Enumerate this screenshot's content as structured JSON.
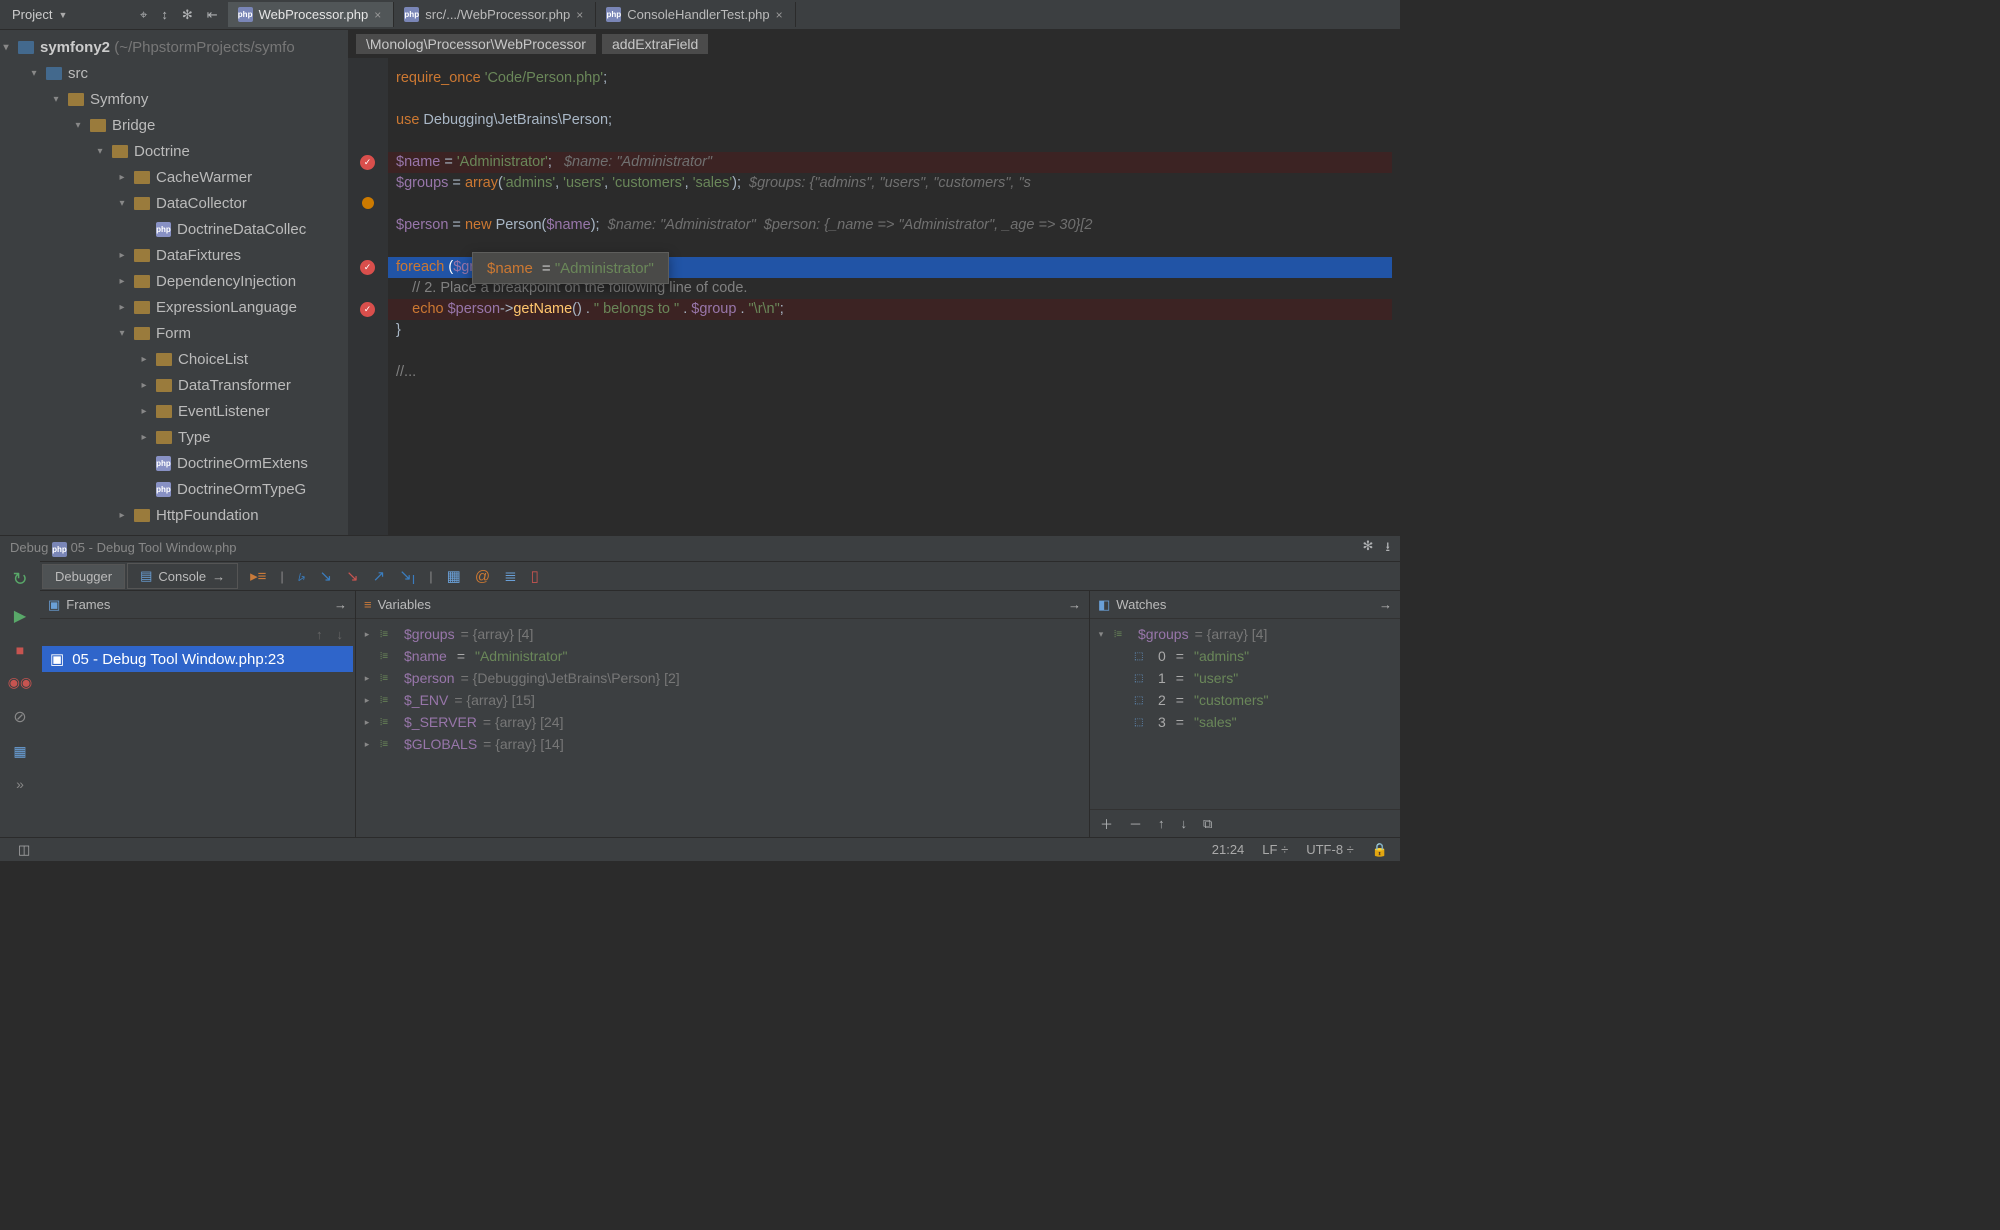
{
  "nav": {
    "project_label": "Project",
    "tabs": [
      {
        "label": "WebProcessor.php",
        "active": true,
        "kind": "php"
      },
      {
        "label": "src/.../WebProcessor.php",
        "active": false,
        "kind": "php"
      },
      {
        "label": "ConsoleHandlerTest.php",
        "active": false,
        "kind": "php"
      }
    ]
  },
  "project_path": {
    "root": "symfony2",
    "root_hint": "(~/PhpstormProjects/symfo",
    "tree": [
      {
        "depth": 0,
        "expand": "▾",
        "icon": "folder-blue",
        "label": "symfony2",
        "bold": true,
        "suffix": " (~/PhpstormProjects/symfo"
      },
      {
        "depth": 1,
        "expand": "▾",
        "icon": "folder-blue",
        "label": "src"
      },
      {
        "depth": 2,
        "expand": "▾",
        "icon": "folder",
        "label": "Symfony"
      },
      {
        "depth": 3,
        "expand": "▾",
        "icon": "folder",
        "label": "Bridge"
      },
      {
        "depth": 4,
        "expand": "▾",
        "icon": "folder",
        "label": "Doctrine"
      },
      {
        "depth": 5,
        "expand": "▸",
        "icon": "folder",
        "label": "CacheWarmer"
      },
      {
        "depth": 5,
        "expand": "▾",
        "icon": "folder",
        "label": "DataCollector"
      },
      {
        "depth": 6,
        "expand": "",
        "icon": "php",
        "label": "DoctrineDataCollec"
      },
      {
        "depth": 5,
        "expand": "▸",
        "icon": "folder",
        "label": "DataFixtures"
      },
      {
        "depth": 5,
        "expand": "▸",
        "icon": "folder",
        "label": "DependencyInjection"
      },
      {
        "depth": 5,
        "expand": "▸",
        "icon": "folder",
        "label": "ExpressionLanguage"
      },
      {
        "depth": 5,
        "expand": "▾",
        "icon": "folder",
        "label": "Form"
      },
      {
        "depth": 6,
        "expand": "▸",
        "icon": "folder",
        "label": "ChoiceList"
      },
      {
        "depth": 6,
        "expand": "▸",
        "icon": "folder",
        "label": "DataTransformer"
      },
      {
        "depth": 6,
        "expand": "▸",
        "icon": "folder",
        "label": "EventListener"
      },
      {
        "depth": 6,
        "expand": "▸",
        "icon": "folder",
        "label": "Type"
      },
      {
        "depth": 6,
        "expand": "",
        "icon": "php",
        "label": "DoctrineOrmExtens"
      },
      {
        "depth": 6,
        "expand": "",
        "icon": "php",
        "label": "DoctrineOrmTypeG"
      },
      {
        "depth": 5,
        "expand": "▸",
        "icon": "folder",
        "label": "HttpFoundation"
      }
    ]
  },
  "editor": {
    "breadcrumbs": [
      "\\Monolog\\Processor\\WebProcessor",
      "addExtraField"
    ],
    "tooltip": {
      "var": "$name",
      "value": "\"Administrator\""
    },
    "code_rows": [
      {
        "html": "<span class='kw'>require_once</span> <span class='str'>'Code/Person.php'</span>;"
      },
      {
        "html": ""
      },
      {
        "html": "<span class='kw'>use</span> Debugging\\JetBrains\\Person;"
      },
      {
        "html": ""
      },
      {
        "cls": "bp-line",
        "bp": true,
        "html": "<span class='var'>$name</span> = <span class='str'>'Administrator'</span>;   <span class='hint'>$name: \"Administrator\"</span>"
      },
      {
        "bulb": true,
        "html": "<span class='var'>$groups</span> = <span class='kw'>array</span>(<span class='str'>'admins'</span>, <span class='str'>'users'</span>, <span class='str'>'customers'</span>, <span class='str'>'sales'</span>);  <span class='hint'>$groups: {\"admins\", \"users\", \"customers\", \"s</span>"
      },
      {
        "html": ""
      },
      {
        "html": "<span class='var'>$person</span> = <span class='new'>new</span> Person(<span class='var'>$name</span>);  <span class='hint'>$name: \"Administrator\"  $person: {_name =&gt; \"Administrator\", _age =&gt; 30}[2</span>"
      },
      {
        "html": ""
      },
      {
        "cls": "hl-line",
        "bp": true,
        "html": "<span class='kw'>foreach</span> (<span class='var'>$gr</span>"
      },
      {
        "html": "    <span class='cmt'>// 2. Place a breakpoint on the following line of code.</span>"
      },
      {
        "cls": "bp-line",
        "bp": true,
        "html": "    <span class='kw'>echo</span> <span class='var'>$person</span>-&gt;<span class='fn'>getName</span>() . <span class='str'>\" belongs to \"</span> . <span class='var'>$group</span> . <span class='str'>\"\\r\\n\"</span>;"
      },
      {
        "html": "}"
      },
      {
        "html": ""
      },
      {
        "html": "<span class='cmt'>//...</span>"
      }
    ]
  },
  "debug": {
    "title": "Debug",
    "config": "05 - Debug Tool Window.php",
    "tabs": {
      "debugger": "Debugger",
      "console": "Console"
    },
    "frames": {
      "title": "Frames",
      "items": [
        "05 - Debug Tool Window.php:23"
      ]
    },
    "variables": {
      "title": "Variables",
      "items": [
        {
          "tw": "▸",
          "name": "$groups",
          "after": " = {array} [4]"
        },
        {
          "tw": "",
          "name": "$name",
          "after": " = ",
          "str": "\"Administrator\""
        },
        {
          "tw": "▸",
          "name": "$person",
          "after": " = {Debugging\\JetBrains\\Person} [2]"
        },
        {
          "tw": "▸",
          "name": "$_ENV",
          "after": " = {array} [15]"
        },
        {
          "tw": "▸",
          "name": "$_SERVER",
          "after": " = {array} [24]"
        },
        {
          "tw": "▸",
          "name": "$GLOBALS",
          "after": " = {array} [14]"
        }
      ]
    },
    "watches": {
      "title": "Watches",
      "root": {
        "tw": "▾",
        "name": "$groups",
        "after": " = {array} [4]"
      },
      "children": [
        {
          "idx": "0",
          "val": "\"admins\""
        },
        {
          "idx": "1",
          "val": "\"users\""
        },
        {
          "idx": "2",
          "val": "\"customers\""
        },
        {
          "idx": "3",
          "val": "\"sales\""
        }
      ]
    }
  },
  "status": {
    "pos": "21:24",
    "line_sep": "LF",
    "encoding": "UTF-8"
  }
}
